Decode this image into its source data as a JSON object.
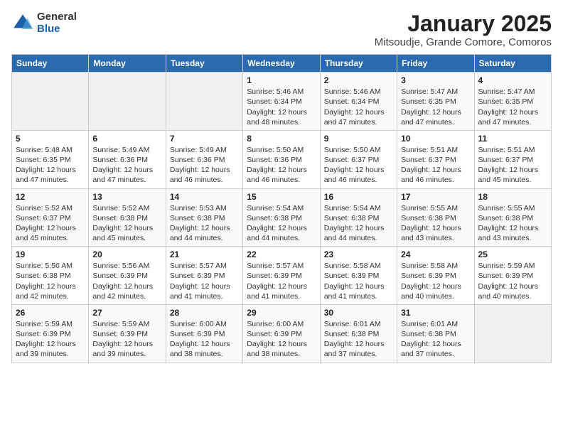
{
  "logo": {
    "general": "General",
    "blue": "Blue"
  },
  "title": "January 2025",
  "subtitle": "Mitsoudje, Grande Comore, Comoros",
  "weekdays": [
    "Sunday",
    "Monday",
    "Tuesday",
    "Wednesday",
    "Thursday",
    "Friday",
    "Saturday"
  ],
  "weeks": [
    [
      null,
      null,
      null,
      {
        "day": "1",
        "sunrise": "5:46 AM",
        "sunset": "6:34 PM",
        "daylight": "12 hours and 48 minutes."
      },
      {
        "day": "2",
        "sunrise": "5:46 AM",
        "sunset": "6:34 PM",
        "daylight": "12 hours and 47 minutes."
      },
      {
        "day": "3",
        "sunrise": "5:47 AM",
        "sunset": "6:35 PM",
        "daylight": "12 hours and 47 minutes."
      },
      {
        "day": "4",
        "sunrise": "5:47 AM",
        "sunset": "6:35 PM",
        "daylight": "12 hours and 47 minutes."
      }
    ],
    [
      {
        "day": "5",
        "sunrise": "5:48 AM",
        "sunset": "6:35 PM",
        "daylight": "12 hours and 47 minutes."
      },
      {
        "day": "6",
        "sunrise": "5:49 AM",
        "sunset": "6:36 PM",
        "daylight": "12 hours and 47 minutes."
      },
      {
        "day": "7",
        "sunrise": "5:49 AM",
        "sunset": "6:36 PM",
        "daylight": "12 hours and 46 minutes."
      },
      {
        "day": "8",
        "sunrise": "5:50 AM",
        "sunset": "6:36 PM",
        "daylight": "12 hours and 46 minutes."
      },
      {
        "day": "9",
        "sunrise": "5:50 AM",
        "sunset": "6:37 PM",
        "daylight": "12 hours and 46 minutes."
      },
      {
        "day": "10",
        "sunrise": "5:51 AM",
        "sunset": "6:37 PM",
        "daylight": "12 hours and 46 minutes."
      },
      {
        "day": "11",
        "sunrise": "5:51 AM",
        "sunset": "6:37 PM",
        "daylight": "12 hours and 45 minutes."
      }
    ],
    [
      {
        "day": "12",
        "sunrise": "5:52 AM",
        "sunset": "6:37 PM",
        "daylight": "12 hours and 45 minutes."
      },
      {
        "day": "13",
        "sunrise": "5:52 AM",
        "sunset": "6:38 PM",
        "daylight": "12 hours and 45 minutes."
      },
      {
        "day": "14",
        "sunrise": "5:53 AM",
        "sunset": "6:38 PM",
        "daylight": "12 hours and 44 minutes."
      },
      {
        "day": "15",
        "sunrise": "5:54 AM",
        "sunset": "6:38 PM",
        "daylight": "12 hours and 44 minutes."
      },
      {
        "day": "16",
        "sunrise": "5:54 AM",
        "sunset": "6:38 PM",
        "daylight": "12 hours and 44 minutes."
      },
      {
        "day": "17",
        "sunrise": "5:55 AM",
        "sunset": "6:38 PM",
        "daylight": "12 hours and 43 minutes."
      },
      {
        "day": "18",
        "sunrise": "5:55 AM",
        "sunset": "6:38 PM",
        "daylight": "12 hours and 43 minutes."
      }
    ],
    [
      {
        "day": "19",
        "sunrise": "5:56 AM",
        "sunset": "6:38 PM",
        "daylight": "12 hours and 42 minutes."
      },
      {
        "day": "20",
        "sunrise": "5:56 AM",
        "sunset": "6:39 PM",
        "daylight": "12 hours and 42 minutes."
      },
      {
        "day": "21",
        "sunrise": "5:57 AM",
        "sunset": "6:39 PM",
        "daylight": "12 hours and 41 minutes."
      },
      {
        "day": "22",
        "sunrise": "5:57 AM",
        "sunset": "6:39 PM",
        "daylight": "12 hours and 41 minutes."
      },
      {
        "day": "23",
        "sunrise": "5:58 AM",
        "sunset": "6:39 PM",
        "daylight": "12 hours and 41 minutes."
      },
      {
        "day": "24",
        "sunrise": "5:58 AM",
        "sunset": "6:39 PM",
        "daylight": "12 hours and 40 minutes."
      },
      {
        "day": "25",
        "sunrise": "5:59 AM",
        "sunset": "6:39 PM",
        "daylight": "12 hours and 40 minutes."
      }
    ],
    [
      {
        "day": "26",
        "sunrise": "5:59 AM",
        "sunset": "6:39 PM",
        "daylight": "12 hours and 39 minutes."
      },
      {
        "day": "27",
        "sunrise": "5:59 AM",
        "sunset": "6:39 PM",
        "daylight": "12 hours and 39 minutes."
      },
      {
        "day": "28",
        "sunrise": "6:00 AM",
        "sunset": "6:39 PM",
        "daylight": "12 hours and 38 minutes."
      },
      {
        "day": "29",
        "sunrise": "6:00 AM",
        "sunset": "6:39 PM",
        "daylight": "12 hours and 38 minutes."
      },
      {
        "day": "30",
        "sunrise": "6:01 AM",
        "sunset": "6:38 PM",
        "daylight": "12 hours and 37 minutes."
      },
      {
        "day": "31",
        "sunrise": "6:01 AM",
        "sunset": "6:38 PM",
        "daylight": "12 hours and 37 minutes."
      },
      null
    ]
  ]
}
